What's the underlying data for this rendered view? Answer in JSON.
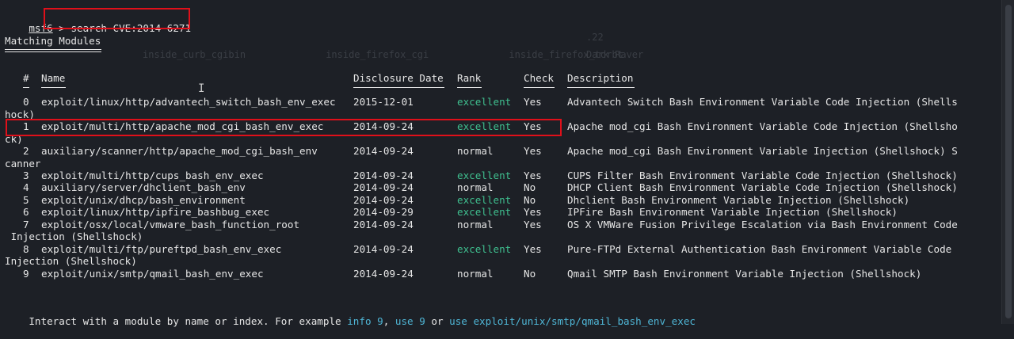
{
  "prompt": {
    "name": "msf6",
    "sep": " > ",
    "command": "search CVE:2014-6271"
  },
  "heading": "Matching Modules",
  "columns": {
    "num": "#",
    "name": "Name",
    "date": "Disclosure Date",
    "rank": "Rank",
    "check": "Check",
    "desc": "Description"
  },
  "rows": [
    {
      "num": "0",
      "name": "exploit/linux/http/advantech_switch_bash_env_exec",
      "date": "2015-12-01",
      "rank": "excellent",
      "check": "Yes",
      "desc": "Advantech Switch Bash Environment Variable Code Injection (Shells",
      "wrap": "hock)"
    },
    {
      "num": "1",
      "name": "exploit/multi/http/apache_mod_cgi_bash_env_exec",
      "date": "2014-09-24",
      "rank": "excellent",
      "check": "Yes",
      "desc": "Apache mod_cgi Bash Environment Variable Code Injection (Shellsho",
      "wrap": "ck)"
    },
    {
      "num": "2",
      "name": "auxiliary/scanner/http/apache_mod_cgi_bash_env",
      "date": "2014-09-24",
      "rank": "normal",
      "check": "Yes",
      "desc": "Apache mod_cgi Bash Environment Variable Injection (Shellshock) S",
      "wrap": "canner"
    },
    {
      "num": "3",
      "name": "exploit/multi/http/cups_bash_env_exec",
      "date": "2014-09-24",
      "rank": "excellent",
      "check": "Yes",
      "desc": "CUPS Filter Bash Environment Variable Code Injection (Shellshock)",
      "wrap": ""
    },
    {
      "num": "4",
      "name": "auxiliary/server/dhclient_bash_env",
      "date": "2014-09-24",
      "rank": "normal",
      "check": "No",
      "desc": "DHCP Client Bash Environment Variable Code Injection (Shellshock)",
      "wrap": ""
    },
    {
      "num": "5",
      "name": "exploit/unix/dhcp/bash_environment",
      "date": "2014-09-24",
      "rank": "excellent",
      "check": "No",
      "desc": "Dhclient Bash Environment Variable Injection (Shellshock)",
      "wrap": ""
    },
    {
      "num": "6",
      "name": "exploit/linux/http/ipfire_bashbug_exec",
      "date": "2014-09-29",
      "rank": "excellent",
      "check": "Yes",
      "desc": "IPFire Bash Environment Variable Injection (Shellshock)",
      "wrap": ""
    },
    {
      "num": "7",
      "name": "exploit/osx/local/vmware_bash_function_root",
      "date": "2014-09-24",
      "rank": "normal",
      "check": "Yes",
      "desc": "OS X VMWare Fusion Privilege Escalation via Bash Environment Code",
      "wrap": " Injection (Shellshock)"
    },
    {
      "num": "8",
      "name": "exploit/multi/ftp/pureftpd_bash_env_exec",
      "date": "2014-09-24",
      "rank": "excellent",
      "check": "Yes",
      "desc": "Pure-FTPd External Authentication Bash Environment Variable Code",
      "wrap": "Injection (Shellshock)"
    },
    {
      "num": "9",
      "name": "exploit/unix/smtp/qmail_bash_env_exec",
      "date": "2014-09-24",
      "rank": "normal",
      "check": "No",
      "desc": "Qmail SMTP Bash Environment Variable Injection (Shellshock)",
      "wrap": ""
    }
  ],
  "footer": {
    "prefix": "Interact with a module by name or index. For example ",
    "info": "info 9",
    "comma": ", ",
    "use_idx": "use 9",
    "or": " or ",
    "use_name": "use exploit/unix/smtp/qmail_bash_env_exec"
  },
  "colors": {
    "background": "#1d2026",
    "text": "#e6e6e6",
    "excellent": "#3fbf8f",
    "hint": "#4fb6d6",
    "highlight_box": "#e0101a"
  }
}
